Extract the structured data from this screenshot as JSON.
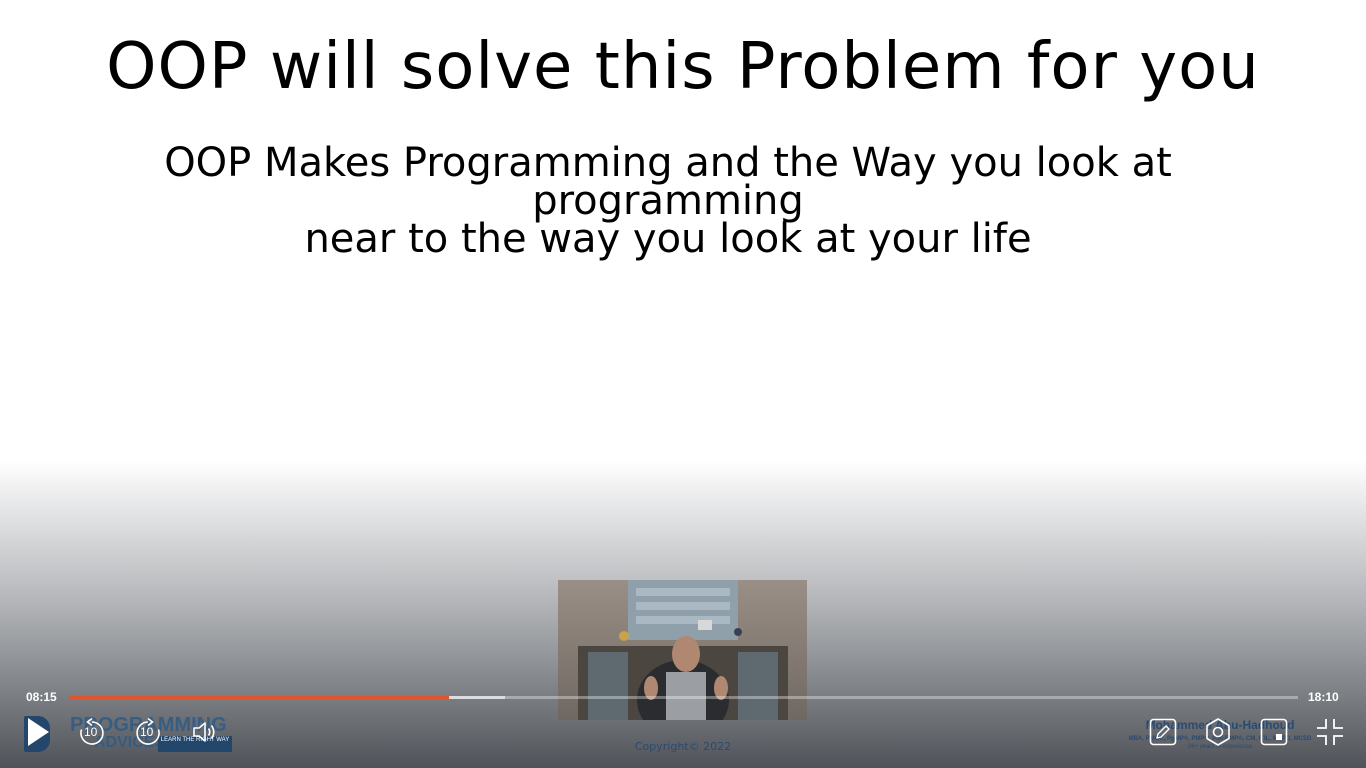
{
  "slide": {
    "title": "OOP will solve this Problem for you",
    "subtitle_line1": "OOP Makes Programming and the Way you look at programming",
    "subtitle_line2": "near to the way you look at your life"
  },
  "branding": {
    "logo_word1": "PROGRAMMING",
    "logo_word2": "ADVICES",
    "logo_tag": "LEARN THE RIGHT WAY",
    "copyright": "Copyright© 2022",
    "author_name": "Mohammed Abu-Hadhoud",
    "author_creds": "MBA, PMOC, PgMP®, PMP®, PMI-RMP®, CM, ITIL, MCPD, MCSD",
    "author_years": "26+ years of experience"
  },
  "player": {
    "current_time": "08:15",
    "duration": "18:10",
    "progress_fraction": 0.3094,
    "buffered_fraction": 0.355,
    "progress_color": "#e2542c",
    "rewind_seconds": "10",
    "forward_seconds": "10",
    "icons": {
      "play": "play-icon",
      "rewind": "rewind-10-icon",
      "forward": "forward-10-icon",
      "volume": "volume-icon",
      "notes": "pencil-icon",
      "settings": "gear-icon",
      "pip": "picture-in-picture-icon",
      "fullscreen": "exit-fullscreen-icon"
    }
  }
}
